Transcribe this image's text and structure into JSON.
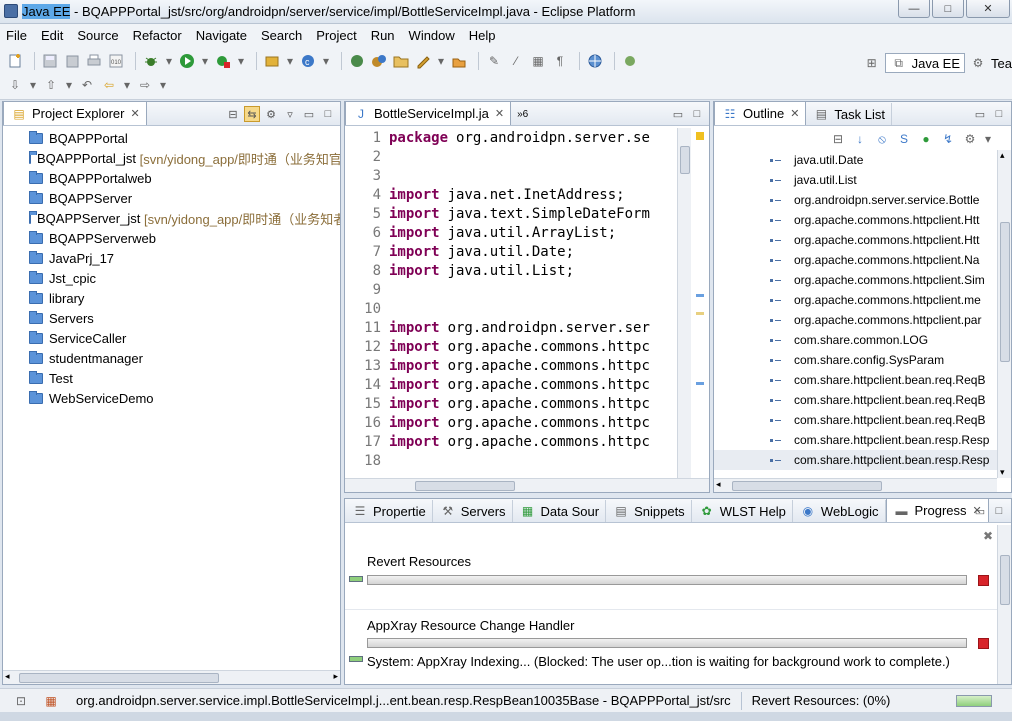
{
  "window": {
    "title_highlight": "Java EE",
    "title_rest": " - BQAPPPortal_jst/src/org/androidpn/server/service/impl/BottleServiceImpl.java - Eclipse Platform",
    "min_glyph": "—",
    "max_glyph": "□",
    "close_glyph": "✕"
  },
  "menu": [
    "File",
    "Edit",
    "Source",
    "Refactor",
    "Navigate",
    "Search",
    "Project",
    "Run",
    "Window",
    "Help"
  ],
  "perspectives": {
    "java_ee": "Java EE",
    "team": "Tea"
  },
  "project_explorer": {
    "tab_label": "Project Explorer",
    "items": [
      {
        "name": "BQAPPPortal",
        "svn": ""
      },
      {
        "name": "BQAPPPortal_jst",
        "svn": "[svn/yidong_app/即时通（业务知官"
      },
      {
        "name": "BQAPPPortalweb",
        "svn": ""
      },
      {
        "name": "BQAPPServer",
        "svn": ""
      },
      {
        "name": "BQAPPServer_jst",
        "svn": "[svn/yidong_app/即时通（业务知者"
      },
      {
        "name": "BQAPPServerweb",
        "svn": ""
      },
      {
        "name": "JavaPrj_17",
        "svn": ""
      },
      {
        "name": "Jst_cpic",
        "svn": ""
      },
      {
        "name": "library",
        "svn": ""
      },
      {
        "name": "Servers",
        "svn": ""
      },
      {
        "name": "ServiceCaller",
        "svn": ""
      },
      {
        "name": "studentmanager",
        "svn": ""
      },
      {
        "name": "Test",
        "svn": ""
      },
      {
        "name": "WebServiceDemo",
        "svn": ""
      }
    ]
  },
  "editor": {
    "tab_label": "BottleServiceImpl.ja",
    "overflow_label": "6",
    "lines": [
      {
        "num": "1",
        "kw": "package",
        "text": "org.androidpn.server.se"
      },
      {
        "num": "2",
        "kw": "",
        "text": ""
      },
      {
        "num": "3",
        "kw": "",
        "text": ""
      },
      {
        "num": "4",
        "kw": "import",
        "text": "java.net.InetAddress;"
      },
      {
        "num": "5",
        "kw": "import",
        "text": "java.text.SimpleDateForm"
      },
      {
        "num": "6",
        "kw": "import",
        "text": "java.util.ArrayList;"
      },
      {
        "num": "7",
        "kw": "import",
        "text": "java.util.Date;"
      },
      {
        "num": "8",
        "kw": "import",
        "text": "java.util.List;"
      },
      {
        "num": "9",
        "kw": "",
        "text": ""
      },
      {
        "num": "10",
        "kw": "",
        "text": ""
      },
      {
        "num": "11",
        "kw": "import",
        "text": "org.androidpn.server.ser"
      },
      {
        "num": "12",
        "kw": "import",
        "text": "org.apache.commons.httpc"
      },
      {
        "num": "13",
        "kw": "import",
        "text": "org.apache.commons.httpc"
      },
      {
        "num": "14",
        "kw": "import",
        "text": "org.apache.commons.httpc"
      },
      {
        "num": "15",
        "kw": "import",
        "text": "org.apache.commons.httpc"
      },
      {
        "num": "16",
        "kw": "import",
        "text": "org.apache.commons.httpc"
      },
      {
        "num": "17",
        "kw": "import",
        "text": "org.apache.commons.httpc"
      },
      {
        "num": "18",
        "kw": "",
        "text": ""
      }
    ]
  },
  "outline": {
    "tab_label": "Outline",
    "tasklist_label": "Task List",
    "items": [
      "java.util.Date",
      "java.util.List",
      "org.androidpn.server.service.Bottle",
      "org.apache.commons.httpclient.Htt",
      "org.apache.commons.httpclient.Htt",
      "org.apache.commons.httpclient.Na",
      "org.apache.commons.httpclient.Sim",
      "org.apache.commons.httpclient.me",
      "org.apache.commons.httpclient.par",
      "com.share.common.LOG",
      "com.share.config.SysParam",
      "com.share.httpclient.bean.req.ReqB",
      "com.share.httpclient.bean.req.ReqB",
      "com.share.httpclient.bean.req.ReqB",
      "com.share.httpclient.bean.resp.Resp",
      "com.share.httpclient.bean.resp.Resp"
    ]
  },
  "bottom_tabs": [
    "Propertie",
    "Servers",
    "Data Sour",
    "Snippets",
    "WLST Help",
    "WebLogic",
    "Progress"
  ],
  "progress": {
    "items": [
      {
        "label": "Revert Resources",
        "detail": ""
      },
      {
        "label": "AppXray Resource Change Handler",
        "detail": "System: AppXray Indexing... (Blocked: The user op...tion is waiting for background work to complete.)"
      }
    ]
  },
  "status": {
    "path": "org.androidpn.server.service.impl.BottleServiceImpl.j...ent.bean.resp.RespBean10035Base - BQAPPPortal_jst/src",
    "job": "Revert Resources: (0%)"
  }
}
